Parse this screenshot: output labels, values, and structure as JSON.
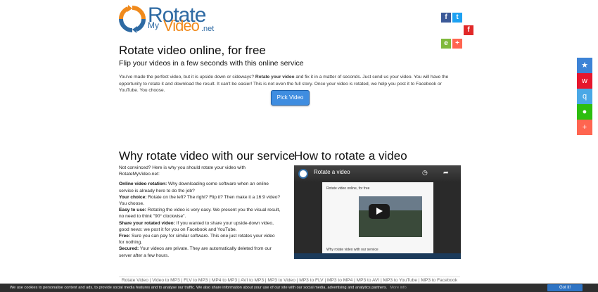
{
  "header": {
    "logo_word1": "Rotate",
    "logo_word2": "My",
    "logo_word3": "Video",
    "logo_word4": ".net",
    "social_top": [
      {
        "icon": "facebook-icon",
        "color": "#3b5998",
        "glyph": "f"
      },
      {
        "icon": "twitter-icon",
        "color": "#1da1f2",
        "glyph": "t"
      },
      {
        "icon": "flipboard-icon",
        "color": "#e12828",
        "glyph": "f"
      },
      {
        "icon": "evernote-icon",
        "color": "#7fb93b",
        "glyph": "e"
      },
      {
        "icon": "plus-share-icon",
        "color": "#ff6550",
        "glyph": "+"
      }
    ]
  },
  "hero": {
    "title": "Rotate video online, for free",
    "subtitle": "Flip your videos in a few seconds with this online service",
    "intro_part1": "You've made the perfect video, but it is upside down or sideways? ",
    "intro_bold": "Rotate your video",
    "intro_part2": " and fix it in a matter of seconds. Just send us your video. You will have the opportunity to rotate it and download the result. It can't be easier! This is not even the full story. Once your video is rotated, we help you post it to Facebook or YouTube. You choose.",
    "pick_button": "Pick Video"
  },
  "why": {
    "heading": "Why rotate video with our service",
    "lead": "Not convinced? Here is why you should rotate your video with RotateMyVideo.net:",
    "items": [
      {
        "label": "Online video rotation:",
        "text": " Why downloading some software when an online service is already here to do the job?"
      },
      {
        "label": "Your choice:",
        "text": " Rotate on the left? The right? Flip it? Then make it a 16:9 video? You choose."
      },
      {
        "label": "Easy to use:",
        "text": " Rotating the video is very easy. We present you the visual result, no need to think \"90° clockwise\"."
      },
      {
        "label": "Share your rotated video:",
        "text": " If you wanted to share your upside-down video, good news: we post it for you on Facebook and YouTube."
      },
      {
        "label": "Free:",
        "text": " Sure you can pay for similar software. This one just rotates your video for nothing."
      },
      {
        "label": "Secured:",
        "text": " Your videos are private. They are automatically deleted from our server after a few hours."
      }
    ]
  },
  "how": {
    "heading": "How to rotate a video",
    "video_title": "Rotate a video",
    "screen_title": "Rotate video online, for free",
    "screen_footer": "Why rotate video with our service"
  },
  "footer": {
    "links": [
      "Rotate Video",
      "Video to MP3",
      "FLV to MP3",
      "MP4 to MP3",
      "AVI to MP3",
      "MP3 to Video",
      "MP3 to FLV",
      "MP3 to MP4",
      "MP3 to AVI",
      "MP3 to YouTube",
      "MP3 to Facebook"
    ]
  },
  "cookie": {
    "text": "We use cookies to personalise content and ads, to provide social media features and to analyse our traffic. We also share information about your use of our site with our social media, advertising and analytics partners.",
    "more": "More info",
    "button": "Got it!"
  },
  "side_share": [
    {
      "icon": "qzone-icon",
      "color": "#3d83d6",
      "glyph": "★"
    },
    {
      "icon": "weibo-icon",
      "color": "#e6162d",
      "glyph": "w"
    },
    {
      "icon": "tencent-icon",
      "color": "#4aa8e6",
      "glyph": "q"
    },
    {
      "icon": "wechat-icon",
      "color": "#2dbe0f",
      "glyph": "●"
    },
    {
      "icon": "more-share-icon",
      "color": "#ff6550",
      "glyph": "+"
    }
  ]
}
